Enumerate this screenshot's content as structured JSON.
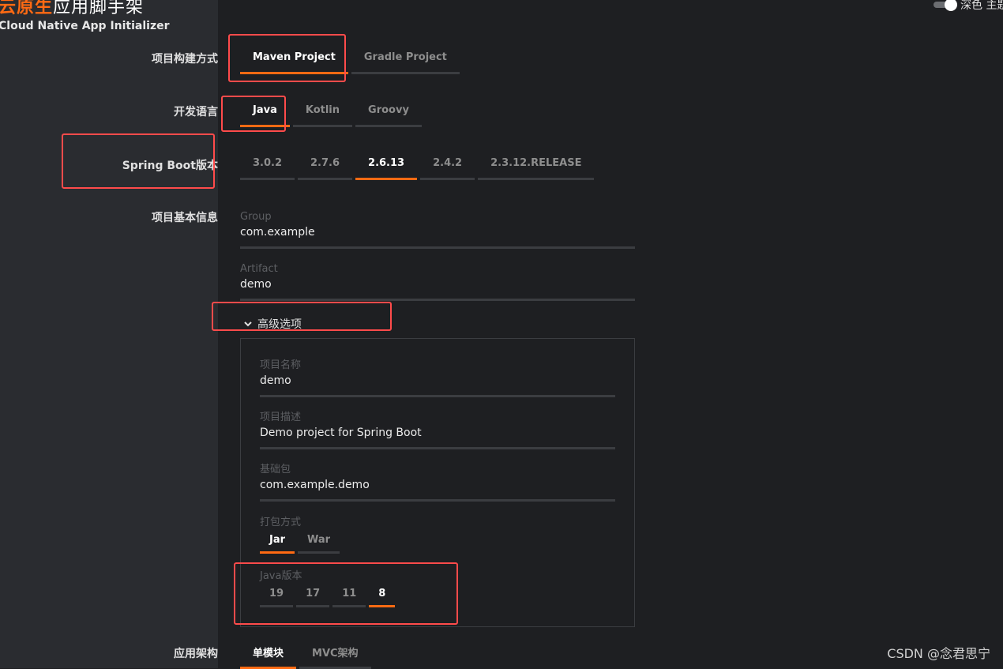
{
  "brand": {
    "accent": "云原生",
    "rest": "应用脚手架",
    "subtitle": "Cloud Native App Initializer",
    "accent_color": "#ff6a13"
  },
  "theme": {
    "label": "深色 主题",
    "on": true
  },
  "sections": {
    "build": {
      "label": "项目构建方式",
      "options": [
        "Maven Project",
        "Gradle Project"
      ],
      "selected": "Maven Project"
    },
    "language": {
      "label": "开发语言",
      "options": [
        "Java",
        "Kotlin",
        "Groovy"
      ],
      "selected": "Java"
    },
    "boot": {
      "label": "Spring Boot版本",
      "options": [
        "3.0.2",
        "2.7.6",
        "2.6.13",
        "2.4.2",
        "2.3.12.RELEASE"
      ],
      "selected": "2.6.13"
    },
    "info": {
      "label": "项目基本信息",
      "group": {
        "label": "Group",
        "value": "com.example"
      },
      "artifact": {
        "label": "Artifact",
        "value": "demo"
      }
    },
    "advanced": {
      "toggle_label": "高级选项",
      "name": {
        "label": "项目名称",
        "value": "demo"
      },
      "description": {
        "label": "项目描述",
        "value": "Demo project for Spring Boot"
      },
      "package": {
        "label": "基础包",
        "value": "com.example.demo"
      },
      "packaging": {
        "label": "打包方式",
        "options": [
          "Jar",
          "War"
        ],
        "selected": "Jar"
      },
      "java": {
        "label": "Java版本",
        "options": [
          "19",
          "17",
          "11",
          "8"
        ],
        "selected": "8"
      }
    },
    "architecture": {
      "label": "应用架构",
      "options": [
        "单模块",
        "MVC架构"
      ],
      "selected": "单模块"
    }
  },
  "watermark": "CSDN @念君思宁",
  "annotation_color": "#ff4b4b"
}
